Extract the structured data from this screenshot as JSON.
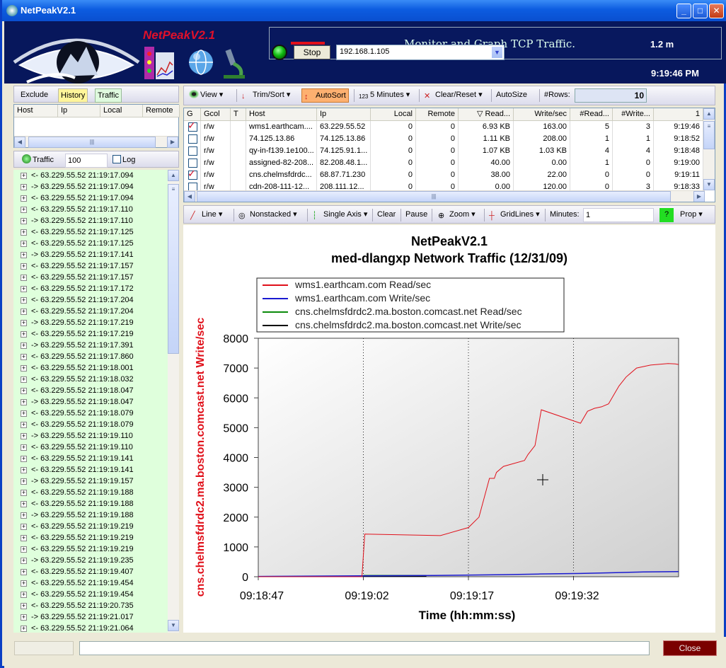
{
  "window": {
    "title": "NetPeakV2.1"
  },
  "header": {
    "logo_text": "NetPeakV2.1",
    "monitor_title": "Monitor and Graph TCP Traffic.",
    "interval": "1.2 m",
    "stop_label": "Stop",
    "ip_value": "192.168.1.105",
    "clock": "9:19:46 PM"
  },
  "left": {
    "tabs": [
      {
        "label": "Exclude"
      },
      {
        "label": "History"
      },
      {
        "label": "Traffic"
      }
    ],
    "cols": [
      {
        "label": "Host"
      },
      {
        "label": "Ip"
      },
      {
        "label": "Local"
      },
      {
        "label": "Remote"
      }
    ],
    "traffic_label": "Traffic",
    "traffic_count": "100",
    "log_label": "Log",
    "tree": [
      {
        "dir": "<-",
        "text": "63.229.55.52 21:19:17.094"
      },
      {
        "dir": "->",
        "text": "63.229.55.52 21:19:17.094"
      },
      {
        "dir": "<-",
        "text": "63.229.55.52 21:19:17.094"
      },
      {
        "dir": "<-",
        "text": "63.229.55.52 21:19:17.110"
      },
      {
        "dir": "->",
        "text": "63.229.55.52 21:19:17.110"
      },
      {
        "dir": "<-",
        "text": "63.229.55.52 21:19:17.125"
      },
      {
        "dir": "<-",
        "text": "63.229.55.52 21:19:17.125"
      },
      {
        "dir": "->",
        "text": "63.229.55.52 21:19:17.141"
      },
      {
        "dir": "<-",
        "text": "63.229.55.52 21:19:17.157"
      },
      {
        "dir": "<-",
        "text": "63.229.55.52 21:19:17.157"
      },
      {
        "dir": "<-",
        "text": "63.229.55.52 21:19:17.172"
      },
      {
        "dir": "<-",
        "text": "63.229.55.52 21:19:17.204"
      },
      {
        "dir": "<-",
        "text": "63.229.55.52 21:19:17.204"
      },
      {
        "dir": "->",
        "text": "63.229.55.52 21:19:17.219"
      },
      {
        "dir": "<-",
        "text": "63.229.55.52 21:19:17.219"
      },
      {
        "dir": "->",
        "text": "63.229.55.52 21:19:17.391"
      },
      {
        "dir": "<-",
        "text": "63.229.55.52 21:19:17.860"
      },
      {
        "dir": "<-",
        "text": "63.229.55.52 21:19:18.001"
      },
      {
        "dir": "<-",
        "text": "63.229.55.52 21:19:18.032"
      },
      {
        "dir": "<-",
        "text": "63.229.55.52 21:19:18.047"
      },
      {
        "dir": "->",
        "text": "63.229.55.52 21:19:18.047"
      },
      {
        "dir": "<-",
        "text": "63.229.55.52 21:19:18.079"
      },
      {
        "dir": "<-",
        "text": "63.229.55.52 21:19:18.079"
      },
      {
        "dir": "->",
        "text": "63.229.55.52 21:19:19.110"
      },
      {
        "dir": "<-",
        "text": "63.229.55.52 21:19:19.110"
      },
      {
        "dir": "<-",
        "text": "63.229.55.52 21:19:19.141"
      },
      {
        "dir": "<-",
        "text": "63.229.55.52 21:19:19.141"
      },
      {
        "dir": "->",
        "text": "63.229.55.52 21:19:19.157"
      },
      {
        "dir": "<-",
        "text": "63.229.55.52 21:19:19.188"
      },
      {
        "dir": "<-",
        "text": "63.229.55.52 21:19:19.188"
      },
      {
        "dir": "->",
        "text": "63.229.55.52 21:19:19.188"
      },
      {
        "dir": "<-",
        "text": "63.229.55.52 21:19:19.219"
      },
      {
        "dir": "<-",
        "text": "63.229.55.52 21:19:19.219"
      },
      {
        "dir": "<-",
        "text": "63.229.55.52 21:19:19.219"
      },
      {
        "dir": "->",
        "text": "63.229.55.52 21:19:19.235"
      },
      {
        "dir": "<-",
        "text": "63.229.55.52 21:19:19.407"
      },
      {
        "dir": "<-",
        "text": "63.229.55.52 21:19:19.454"
      },
      {
        "dir": "<-",
        "text": "63.229.55.52 21:19:19.454"
      },
      {
        "dir": "<-",
        "text": "63.229.55.52 21:19:20.735"
      },
      {
        "dir": "->",
        "text": "63.229.55.52 21:19:21.017"
      },
      {
        "dir": "<-",
        "text": "63.229.55.52 21:19:21.064"
      }
    ]
  },
  "toolbar1": {
    "view": "View",
    "trim": "Trim/Sort",
    "autosort": "AutoSort",
    "minutes": "5 Minutes",
    "clear": "Clear/Reset",
    "autosize": "AutoSize",
    "rows_label": "#Rows:",
    "rows": "10"
  },
  "table": {
    "cols": [
      "G",
      "Gcol",
      "T",
      "Host",
      "Ip",
      "Local",
      "Remote",
      "Read...",
      "Write/sec",
      "#Read...",
      "#Write...",
      "1"
    ],
    "rows": [
      {
        "checked": true,
        "gcol": "r/w",
        "host": "wms1.earthcam....",
        "ip": "63.229.55.52",
        "local": "0",
        "remote": "0",
        "read": "6.93 KB",
        "write": "163.00",
        "nread": "5",
        "nwrite": "3",
        "time": "9:19:46"
      },
      {
        "checked": false,
        "gcol": "r/w",
        "host": "74.125.13.86",
        "ip": "74.125.13.86",
        "local": "0",
        "remote": "0",
        "read": "1.11 KB",
        "write": "208.00",
        "nread": "1",
        "nwrite": "1",
        "time": "9:18:52"
      },
      {
        "checked": false,
        "gcol": "r/w",
        "host": "qy-in-f139.1e100...",
        "ip": "74.125.91.1...",
        "local": "0",
        "remote": "0",
        "read": "1.07 KB",
        "write": "1.03 KB",
        "nread": "4",
        "nwrite": "4",
        "time": "9:18:48"
      },
      {
        "checked": false,
        "gcol": "r/w",
        "host": "assigned-82-208...",
        "ip": "82.208.48.1...",
        "local": "0",
        "remote": "0",
        "read": "40.00",
        "write": "0.00",
        "nread": "1",
        "nwrite": "0",
        "time": "9:19:00"
      },
      {
        "checked": true,
        "gcol": "r/w",
        "host": "cns.chelmsfdrdc...",
        "ip": "68.87.71.230",
        "local": "0",
        "remote": "0",
        "read": "38.00",
        "write": "22.00",
        "nread": "0",
        "nwrite": "0",
        "time": "9:19:11"
      },
      {
        "checked": false,
        "gcol": "r/w",
        "host": "cdn-208-111-12...",
        "ip": "208.111.12...",
        "local": "0",
        "remote": "0",
        "read": "0.00",
        "write": "120.00",
        "nread": "0",
        "nwrite": "3",
        "time": "9:18:33"
      }
    ]
  },
  "toolbar2": {
    "line": "Line",
    "nonstacked": "Nonstacked",
    "single_axis": "Single Axis",
    "clear": "Clear",
    "pause": "Pause",
    "zoom": "Zoom",
    "gridlines": "GridLines",
    "minutes_label": "Minutes:",
    "minutes_value": "1",
    "help": "?",
    "prop": "Prop"
  },
  "chart_data": {
    "type": "line",
    "title": "NetPeakV2.1",
    "subtitle": "med-dlangxp Network Traffic (12/31/09)",
    "xlabel": "Time (hh:mm:ss)",
    "ylabel": "cns.chelmsfdrdc2.ma.boston.comcast.net Write/sec",
    "xticks": [
      "09:18:47",
      "09:19:02",
      "09:19:17",
      "09:19:32"
    ],
    "xlim": [
      0,
      60
    ],
    "ylim": [
      0,
      8000
    ],
    "yticks": [
      0,
      1000,
      2000,
      3000,
      4000,
      5000,
      6000,
      7000,
      8000
    ],
    "grid": true,
    "legend_position": "top",
    "series": [
      {
        "name": "wms1.earthcam.com Read/sec",
        "color": "#e0101a",
        "x": [
          0,
          14.4,
          14.8,
          15.2,
          26,
          30,
          31.5,
          33,
          33.7,
          34,
          35,
          38,
          38.5,
          39.5,
          40.4,
          46,
          47,
          48,
          49,
          50,
          51,
          51.5,
          52.5,
          54,
          56,
          58.5,
          59.5,
          60
        ],
        "y": [
          0,
          0,
          0,
          1430,
          1380,
          1650,
          2000,
          3300,
          3300,
          3500,
          3700,
          3900,
          4100,
          4400,
          5600,
          5150,
          5550,
          5650,
          5700,
          5800,
          6200,
          6400,
          6700,
          7000,
          7100,
          7150,
          7140,
          7120
        ]
      },
      {
        "name": "wms1.earthcam.com Write/sec",
        "color": "#1a1ad0",
        "x": [
          0,
          15,
          25,
          35,
          40,
          46,
          50,
          55,
          60
        ],
        "y": [
          10,
          30,
          40,
          70,
          90,
          110,
          130,
          160,
          170
        ]
      },
      {
        "name": "cns.chelmsfdrdc2.ma.boston.comcast.net Read/sec",
        "color": "#0a8a0a",
        "x": [
          15,
          24
        ],
        "y": [
          40,
          40
        ]
      },
      {
        "name": "cns.chelmsfdrdc2.ma.boston.comcast.net Write/sec",
        "color": "#000000",
        "x": [
          15,
          24
        ],
        "y": [
          20,
          20
        ]
      }
    ]
  },
  "status": {
    "close": "Close"
  }
}
